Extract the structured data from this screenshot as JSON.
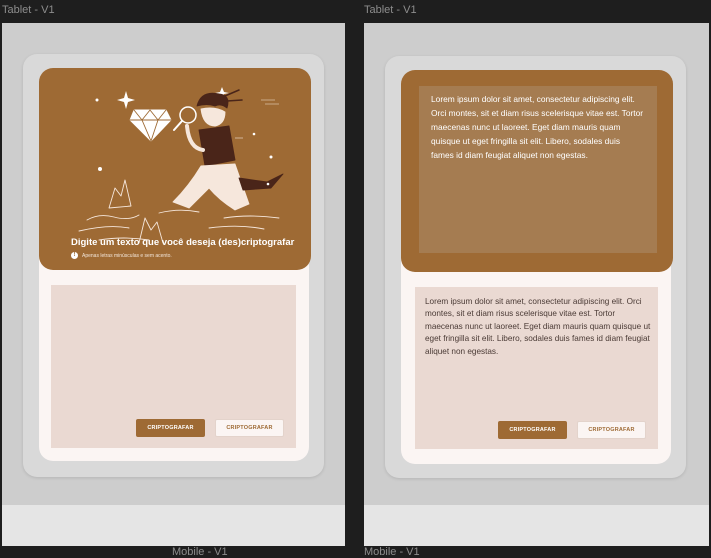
{
  "left_frame": {
    "label": "Tablet - V1",
    "bottom_label": "Mobile - V1",
    "hero": {
      "title": "Digite um texto que você deseja (des)criptografar",
      "hint": "Apenas letras minúsculas e sem acento."
    },
    "buttons": {
      "encrypt": "CRIPTOGRAFAR",
      "decrypt": "CRIPTOGRAFAR"
    }
  },
  "right_frame": {
    "label": "Tablet - V1",
    "bottom_label": "Mobile - V1",
    "input_text": "Lorem ipsum dolor sit amet, consectetur adipiscing elit. Orci montes, sit et diam risus scelerisque vitae est. Tortor maecenas nunc ut laoreet. Eget diam mauris quam quisque ut eget fringilla sit elit. Libero, sodales duis fames id diam feugiat aliquet non egestas.",
    "output_text": "Lorem ipsum dolor sit amet, consectetur adipiscing elit. Orci montes, sit et diam risus scelerisque vitae est. Tortor maecenas nunc ut laoreet. Eget diam mauris quam quisque ut eget fringilla sit elit. Libero, sodales duis fames id diam feugiat aliquet non egestas.",
    "buttons": {
      "encrypt": "CRIPTOGRAFAR",
      "decrypt": "CRIPTOGRAFAR"
    }
  },
  "colors": {
    "brand": "#9e6a34",
    "surface": "#fbf5f3",
    "result_bg": "#ead9d2",
    "text": "#4a3a35"
  },
  "illustration": "kneeling-person-with-magnifying-glass-and-diamond"
}
